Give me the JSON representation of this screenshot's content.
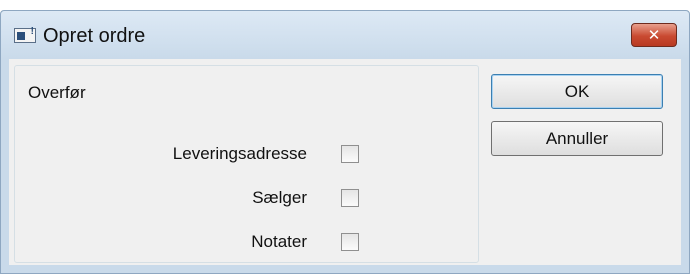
{
  "window": {
    "title": "Opret ordre",
    "close_symbol": "✕",
    "icon": "app-window-icon"
  },
  "group": {
    "label": "Overfør",
    "options": [
      {
        "label": "Leveringsadresse",
        "checked": false
      },
      {
        "label": "Sælger",
        "checked": false
      },
      {
        "label": "Notater",
        "checked": false
      }
    ]
  },
  "buttons": {
    "ok": "OK",
    "cancel": "Annuller"
  }
}
